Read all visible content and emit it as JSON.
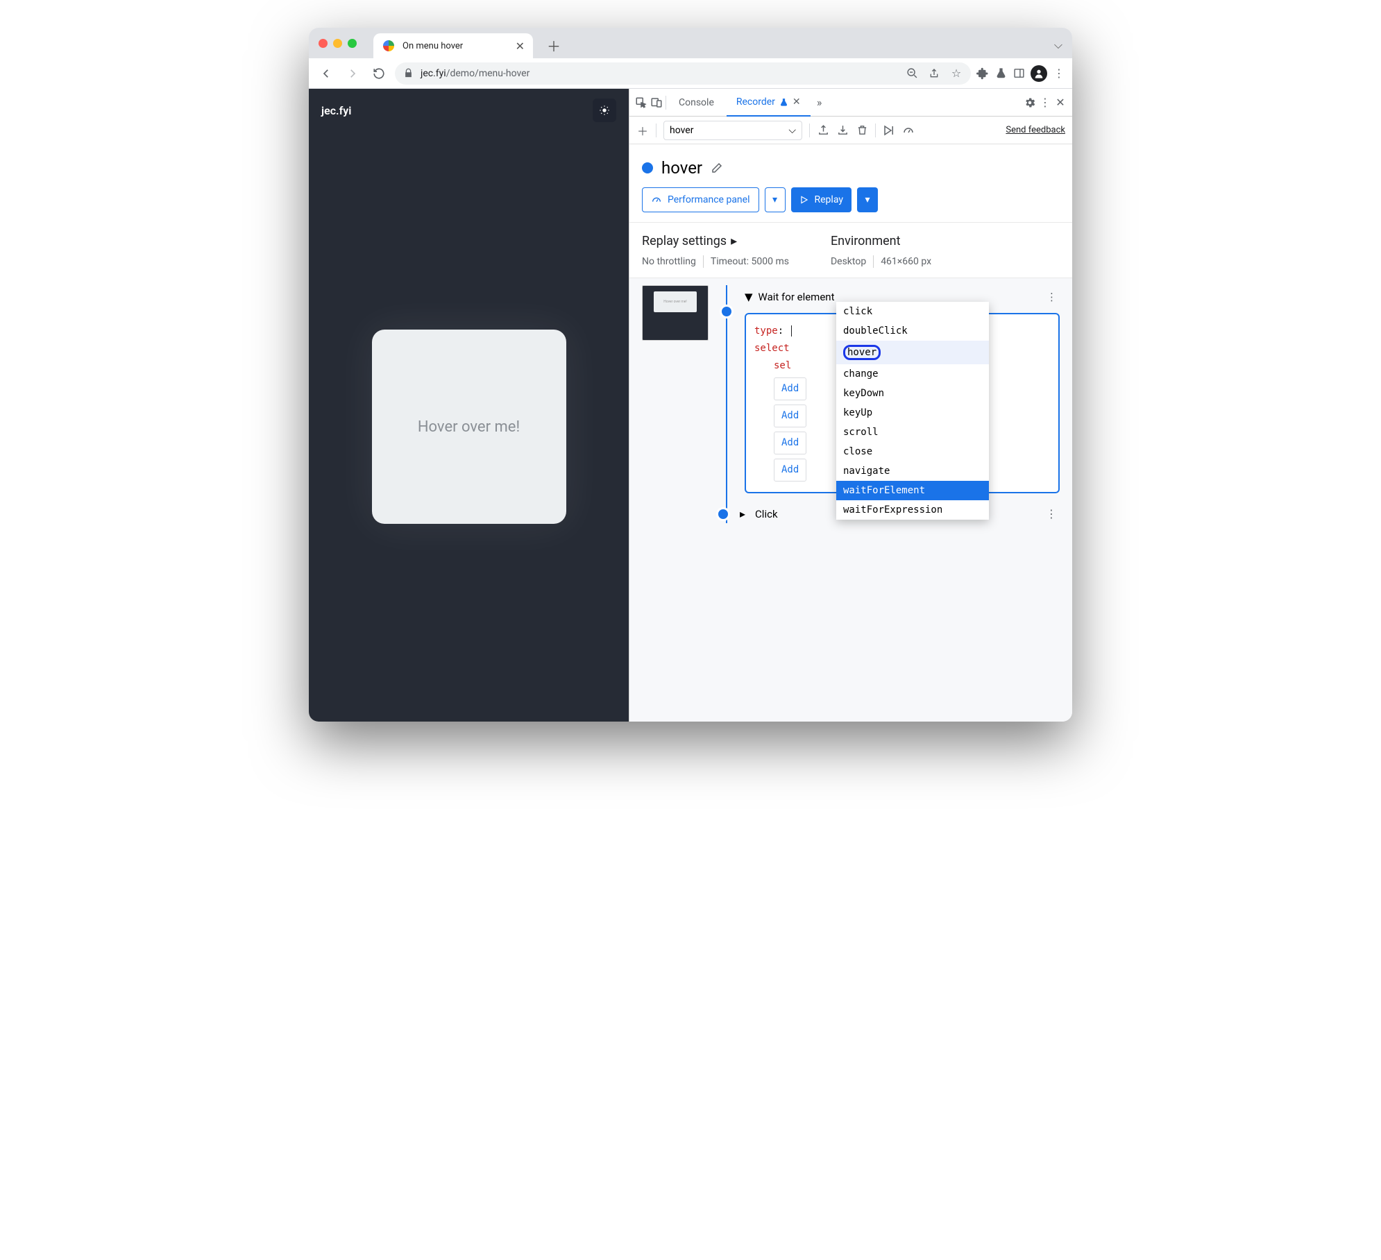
{
  "tab": {
    "title": "On menu hover"
  },
  "address": {
    "host": "jec.fyi",
    "path": "/demo/menu-hover"
  },
  "page": {
    "brand": "jec.fyi",
    "card_text": "Hover over me!"
  },
  "devtools": {
    "tabs": {
      "console": "Console",
      "recorder": "Recorder"
    },
    "recording_select": "hover",
    "feedback": "Send feedback",
    "recording_name": "hover",
    "perf_panel": "Performance panel",
    "replay": "Replay",
    "replay_settings": {
      "header": "Replay settings",
      "throttling": "No throttling",
      "timeout": "Timeout: 5000 ms"
    },
    "environment": {
      "header": "Environment",
      "device": "Desktop",
      "viewport": "461×660 px"
    },
    "step": {
      "title": "Wait for element",
      "thumb_text": "Hover over me!",
      "type_key": "type",
      "colon": ": ",
      "selectors_key_partial": "select",
      "sel_partial": "sel",
      "add_btn": "Add"
    },
    "dropdown": {
      "options": [
        "click",
        "doubleClick",
        "hover",
        "change",
        "keyDown",
        "keyUp",
        "scroll",
        "close",
        "navigate",
        "waitForElement",
        "waitForExpression"
      ],
      "ringed": "hover",
      "selected": "waitForElement",
      "highlighted": "hover"
    },
    "click_step": "Click"
  }
}
